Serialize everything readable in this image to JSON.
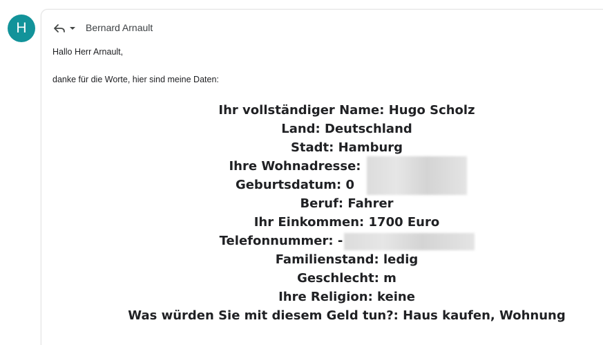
{
  "avatar": {
    "initial": "H",
    "color": "#12939a"
  },
  "header": {
    "reply_icon": "reply-icon",
    "dropdown_icon": "caret-down-icon",
    "recipient": "Bernard Arnault"
  },
  "body": {
    "greeting": "Hallo Herr Arnault,",
    "intro": "danke für die Worte, hier sind meine Daten:",
    "data_lines": [
      "Ihr vollständiger Name: Hugo Scholz",
      "Land: Deutschland",
      "Stadt: Hamburg",
      "Ihre Wohnadresse:",
      "Geburtsdatum: 0",
      "Beruf: Fahrer",
      "Ihr Einkommen: 1700 Euro",
      "Telefonnummer: -",
      "Familienstand: ledig",
      "Geschlecht: m",
      "Ihre Religion: keine",
      "Was würden Sie mit diesem Geld tun?: Haus kaufen, Wohnung"
    ]
  }
}
